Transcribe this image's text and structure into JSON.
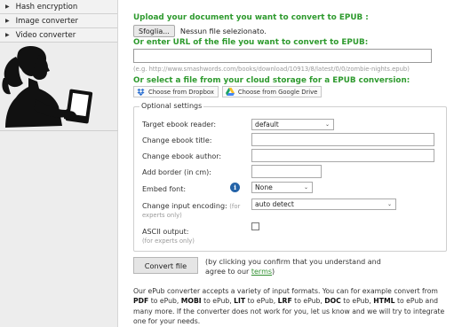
{
  "sidebar": {
    "items": [
      {
        "label": "Hash encryption"
      },
      {
        "label": "Image converter"
      },
      {
        "label": "Video converter"
      }
    ]
  },
  "upload": {
    "heading": "Upload your document you want to convert to EPUB :",
    "browse_label": "Sfoglia...",
    "file_status": "Nessun file selezionato."
  },
  "url": {
    "heading": "Or enter URL of the file you want to convert to EPUB:",
    "value": "",
    "hint": "(e.g. http://www.smashwords.com/books/download/10913/8/latest/0/0/zombie-nights.epub)"
  },
  "cloud": {
    "heading": "Or select a file from your cloud storage for a EPUB conversion:",
    "dropbox_label": "Choose from Dropbox",
    "gdrive_label": "Choose from Google Drive"
  },
  "options": {
    "legend": "Optional settings",
    "target_reader": {
      "label": "Target ebook reader:",
      "value": "default"
    },
    "title": {
      "label": "Change ebook title:",
      "value": ""
    },
    "author": {
      "label": "Change ebook author:",
      "value": ""
    },
    "border": {
      "label": "Add border (in cm):",
      "value": ""
    },
    "embed_font": {
      "label": "Embed font:",
      "value": "None"
    },
    "encoding": {
      "label": "Change input encoding:",
      "sub": "(for",
      "sub2": "experts only)",
      "value": "auto detect"
    },
    "ascii": {
      "label": "ASCII output:",
      "sub": "(for experts only)",
      "checked": false
    }
  },
  "convert": {
    "button_label": "Convert file",
    "confirm_prefix": "(by clicking you confirm that you understand and agree to our ",
    "terms_link": "terms",
    "confirm_suffix": ")"
  },
  "description": {
    "t1": "Our ePub converter accepts a variety of input formats. You can for example convert from ",
    "pdf": "PDF",
    "t2": " to ePub, ",
    "mobi": "MOBI",
    "t3": " to ePub, ",
    "lit": "LIT",
    "t4": " to ePub, ",
    "lrf": "LRF",
    "t5": " to ePub, ",
    "doc": "DOC",
    "t6": " to ePub, ",
    "html": "HTML",
    "t7": " to ePub and many more. If the converter does not work for you, let us know and we will try to integrate one for your needs."
  },
  "colors": {
    "heading_green": "#2e9a2e",
    "info_blue": "#2463a8"
  }
}
